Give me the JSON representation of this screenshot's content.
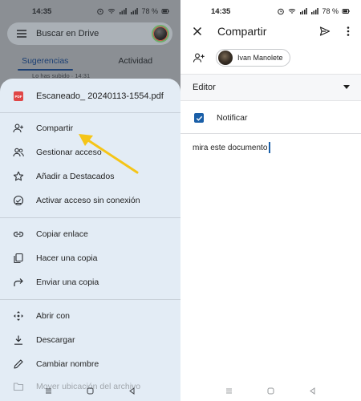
{
  "left": {
    "status": {
      "time": "14:35",
      "battery": "78 %"
    },
    "search": {
      "placeholder_text": "Buscar en Drive"
    },
    "tabs": [
      {
        "label": "Sugerencias",
        "active": true
      },
      {
        "label": "Actividad",
        "active": false
      }
    ],
    "behind_text": "Lo has subido · 14:31",
    "sheet": {
      "file_name": "Escaneado_ 20240113-1554.pdf",
      "pdf_badge": "PDF",
      "items": [
        {
          "label": "Compartir",
          "icon": "person-add-icon"
        },
        {
          "label": "Gestionar acceso",
          "icon": "people-icon"
        },
        {
          "label": "Añadir a Destacados",
          "icon": "star-icon"
        },
        {
          "label": "Activar acceso sin conexión",
          "icon": "offline-icon"
        },
        {
          "label": "Copiar enlace",
          "icon": "link-icon"
        },
        {
          "label": "Hacer una copia",
          "icon": "copy-icon"
        },
        {
          "label": "Enviar una copia",
          "icon": "forward-icon"
        },
        {
          "label": "Abrir con",
          "icon": "open-with-icon"
        },
        {
          "label": "Descargar",
          "icon": "download-icon"
        },
        {
          "label": "Cambiar nombre",
          "icon": "edit-icon"
        },
        {
          "label": "Mover ubicación del archivo",
          "icon": "folder-icon"
        }
      ]
    },
    "annotation_color": "#f5c518"
  },
  "right": {
    "status": {
      "time": "14:35",
      "battery": "78 %"
    },
    "title": "Compartir",
    "chip_name": "Ivan Manolete",
    "role": "Editor",
    "notify_label": "Notificar",
    "notify_checked": true,
    "message": "mira este documento"
  },
  "colors": {
    "accent": "#1a5fa8",
    "tab_active": "#1b3f73",
    "sheet_bg": "#e3ecf5",
    "pdf_red": "#e04646"
  }
}
